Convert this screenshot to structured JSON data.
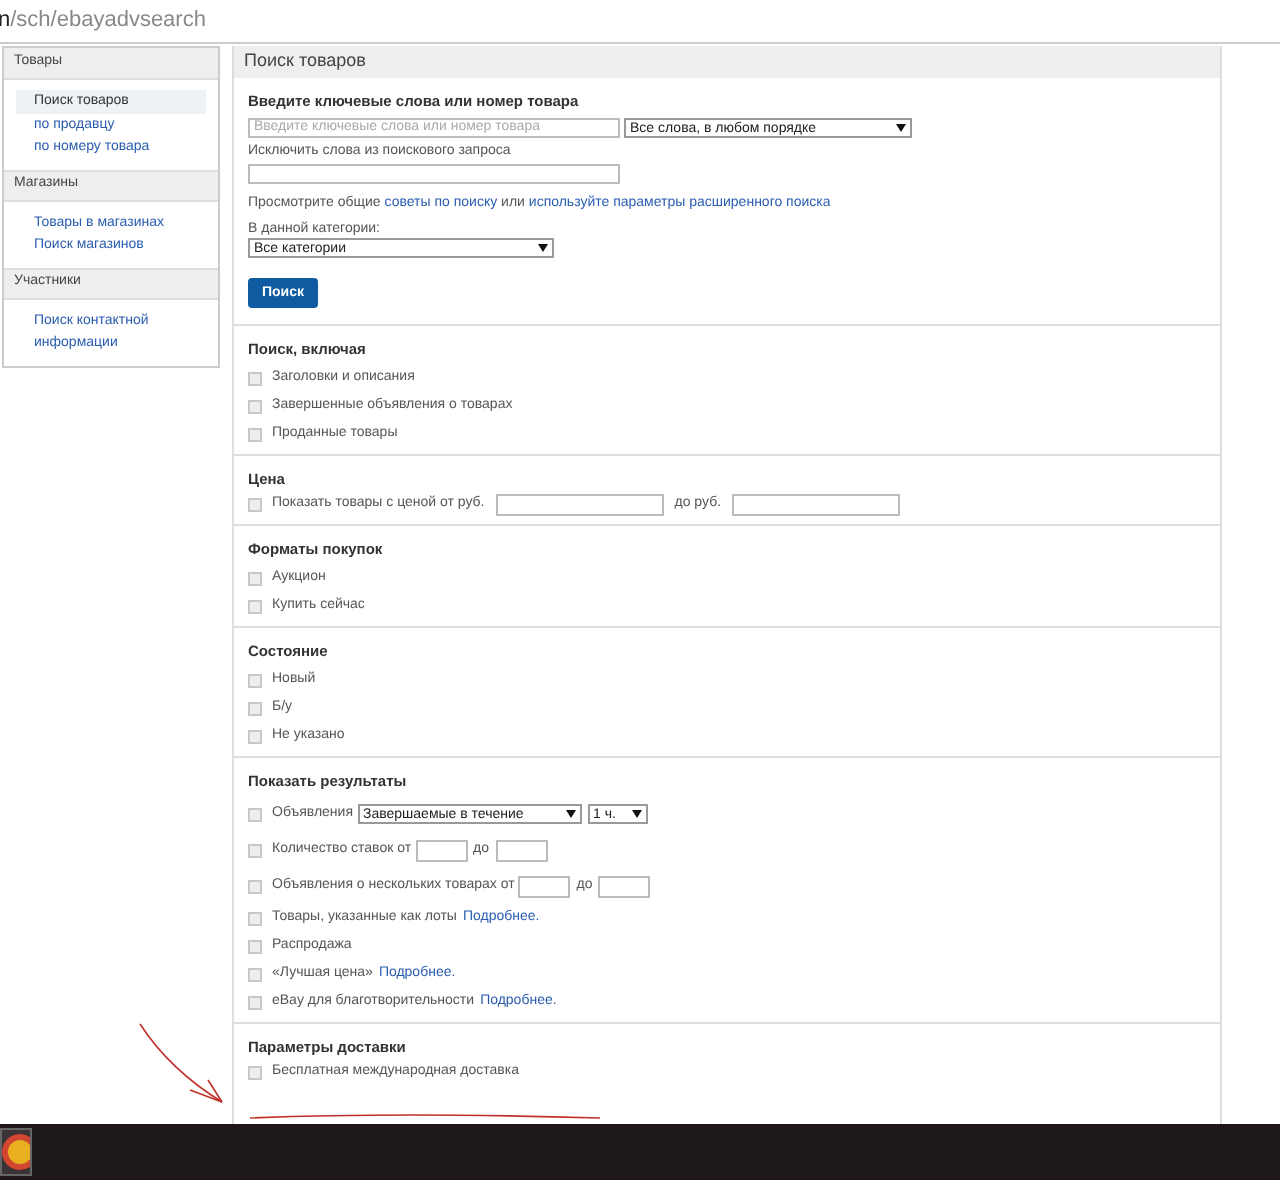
{
  "address_bar": {
    "host_tail": "n",
    "path": "/sch/ebayadvsearch"
  },
  "sidebar": {
    "groups": [
      {
        "title": "Товары",
        "items": [
          {
            "label": "Поиск товаров",
            "selected": true
          },
          {
            "label": "по продавцу",
            "selected": false
          },
          {
            "label": "по номеру товара",
            "selected": false
          }
        ]
      },
      {
        "title": "Магазины",
        "items": [
          {
            "label": "Товары в магазинах",
            "selected": false
          },
          {
            "label": "Поиск магазинов",
            "selected": false
          }
        ]
      },
      {
        "title": "Участники",
        "items": [
          {
            "label": "Поиск контактной информации",
            "selected": false
          }
        ]
      }
    ]
  },
  "main": {
    "title": "Поиск товаров",
    "keywords": {
      "label": "Введите ключевые слова или номер товара",
      "placeholder": "Введите ключевые слова или номер товара",
      "order": "Все слова, в любом порядке"
    },
    "exclude": {
      "label": "Исключить слова из поискового запроса"
    },
    "hint": {
      "before": "Просмотрите общие",
      "link_1": "советы по поиску",
      "middle": "или",
      "link_2": "используйте параметры расширенного поиска"
    },
    "category": {
      "label": "В данной категории:",
      "value": "Все категории"
    },
    "search_button": "Поиск"
  },
  "sections": [
    {
      "title": "Поиск, включая",
      "rows": [
        {
          "kind": "checkbox",
          "label": "Заголовки и описания",
          "checked": false
        },
        {
          "kind": "checkbox",
          "label": "Завершенные объявления о товарах",
          "checked": false
        },
        {
          "kind": "checkbox",
          "label": "Проданные товары",
          "checked": false
        }
      ]
    },
    {
      "title": "Цена",
      "rows": [
        {
          "kind": "price",
          "label": "Показать товары с ценой от руб.",
          "to_label": "до руб.",
          "checked": false
        }
      ]
    },
    {
      "title": "Форматы покупок",
      "rows": [
        {
          "kind": "checkbox",
          "label": "Аукцион",
          "checked": false
        },
        {
          "kind": "checkbox",
          "label": "Купить сейчас",
          "checked": false
        }
      ]
    },
    {
      "title": "Состояние",
      "rows": [
        {
          "kind": "checkbox",
          "label": "Новый",
          "checked": false
        },
        {
          "kind": "checkbox",
          "label": "Б/у",
          "checked": false
        },
        {
          "kind": "checkbox",
          "label": "Не указано",
          "checked": false
        }
      ]
    },
    {
      "title": "Показать результаты",
      "rows": [
        {
          "kind": "select",
          "label": "Объявления",
          "select_1": "Завершаемые в течение",
          "select_2": "1 ч.",
          "checked": false
        },
        {
          "kind": "range",
          "label": "Количество ставок от",
          "to_label": "до",
          "checked": false
        },
        {
          "kind": "range",
          "label": "Объявления о нескольких товарах от",
          "to_label": "до",
          "checked": false
        },
        {
          "kind": "checkbox",
          "label": "Товары, указанные как лоты",
          "link": "Подробнее.",
          "checked": false
        },
        {
          "kind": "checkbox",
          "label": "Распродажа",
          "checked": false
        },
        {
          "kind": "checkbox",
          "label": "«Лучшая цена»",
          "link": "Подробнее.",
          "checked": false
        },
        {
          "kind": "checkbox",
          "label": "eBay для благотворительности",
          "link": "Подробнее.",
          "checked": false
        }
      ]
    },
    {
      "title": "Параметры доставки",
      "rows": [
        {
          "kind": "checkbox",
          "label": "Бесплатная международная доставка",
          "checked": false
        }
      ]
    }
  ]
}
